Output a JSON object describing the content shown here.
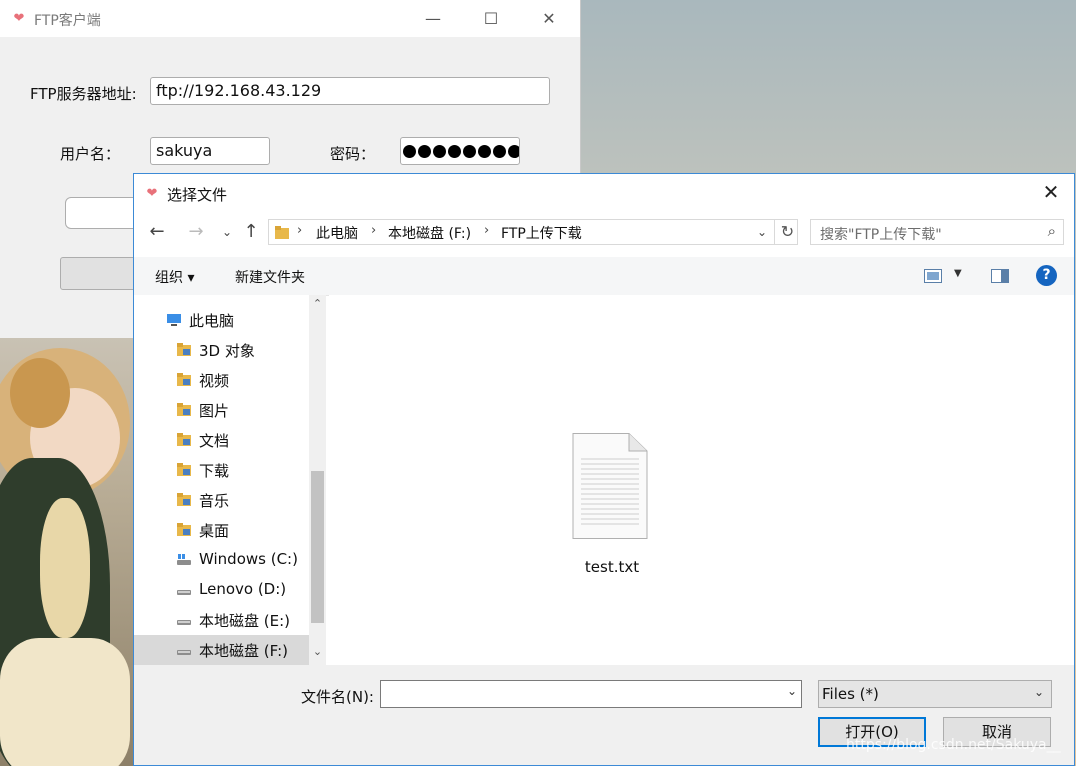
{
  "ftp_client": {
    "title": "FTP客户端",
    "minimize_glyph": "—",
    "maximize_glyph": "☐",
    "close_glyph": "✕",
    "server_label": "FTP服务器地址:",
    "server_value": "ftp://192.168.43.129",
    "username_label": "用户名：",
    "username_value": "sakuya",
    "password_label": "密码：",
    "password_dot_count": 8
  },
  "dialog": {
    "title": "选择文件",
    "close_glyph": "✕",
    "breadcrumbs": [
      "此电脑",
      "本地磁盘 (F:)",
      "FTP上传下载"
    ],
    "search_placeholder": "搜索\"FTP上传下载\"",
    "toolbar": {
      "organize_label": "组织 ▾",
      "new_folder_label": "新建文件夹",
      "help_glyph": "?"
    },
    "nav_items": [
      {
        "label": "此电脑",
        "icon": "computer-icon"
      },
      {
        "label": "3D 对象",
        "icon": "3d-objects-folder-icon"
      },
      {
        "label": "视频",
        "icon": "videos-folder-icon"
      },
      {
        "label": "图片",
        "icon": "pictures-folder-icon"
      },
      {
        "label": "文档",
        "icon": "documents-folder-icon"
      },
      {
        "label": "下载",
        "icon": "downloads-folder-icon"
      },
      {
        "label": "音乐",
        "icon": "music-folder-icon"
      },
      {
        "label": "桌面",
        "icon": "desktop-folder-icon"
      },
      {
        "label": "Windows (C:)",
        "icon": "system-drive-icon"
      },
      {
        "label": "Lenovo (D:)",
        "icon": "drive-icon"
      },
      {
        "label": "本地磁盘 (E:)",
        "icon": "drive-icon"
      },
      {
        "label": "本地磁盘 (F:)",
        "icon": "drive-icon",
        "selected": true
      }
    ],
    "files": [
      {
        "name": "test.txt",
        "icon": "text-file-icon"
      }
    ],
    "filename_label": "文件名(N):",
    "filename_value": "",
    "filter_value": "Files  (*)",
    "open_label": "打开(O)",
    "cancel_label": "取消"
  },
  "watermark": "https://blog.csdn.net/Sakuya__",
  "colors": {
    "accent": "#0078d7",
    "help_blue": "#1565c0",
    "app_icon": "#e8717a",
    "selection": "#d9d9d9"
  }
}
